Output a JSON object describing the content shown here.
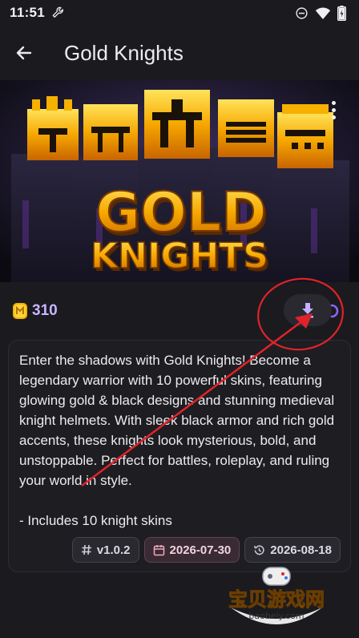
{
  "status_bar": {
    "time": "11:51"
  },
  "app_bar": {
    "title": "Gold Knights"
  },
  "banner": {
    "logo_line1": "GOLD",
    "logo_line2": "KNIGHTS"
  },
  "product": {
    "price": "310"
  },
  "description": {
    "text": "Enter the shadows with Gold Knights! Become a legendary warrior with 10 powerful skins, featuring glowing gold & black designs and stunning medieval knight helmets. With sleek black armor and rich gold accents, these knights look mysterious, bold, and unstoppable. Perfect for battles, roleplay, and ruling your world in style.\n\n- Includes 10 knight skins"
  },
  "chips": {
    "version": "v1.0.2",
    "created": "2026-07-30",
    "updated": "2026-08-18"
  },
  "watermark": {
    "text": "宝贝游戏网",
    "url": "baobeiy.com"
  },
  "colors": {
    "background": "#1b1a1f",
    "price_accent": "#c8b6ff",
    "download_icon": "#c4b0ff",
    "annotation_red": "#e0232a",
    "gold": "#f5b400"
  }
}
